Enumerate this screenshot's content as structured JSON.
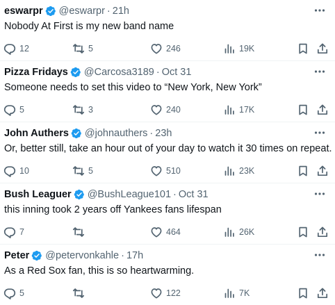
{
  "colors": {
    "verified_badge": "#1d9bf0",
    "secondary_text": "#536471",
    "primary_text": "#0f1419",
    "divider": "#eff3f4"
  },
  "icons": [
    "verified-badge-icon",
    "more-icon",
    "reply-icon",
    "retweet-icon",
    "like-icon",
    "views-icon",
    "bookmark-icon",
    "share-icon"
  ],
  "tweets": [
    {
      "name": "eswarpr",
      "handle": "@eswarpr",
      "sep": "·",
      "time": "21h",
      "text": "Nobody At First is my new band name",
      "replies": "12",
      "retweets": "5",
      "likes": "246",
      "views": "19K"
    },
    {
      "name": "Pizza Fridays",
      "handle": "@Carcosa3189",
      "sep": "·",
      "time": "Oct 31",
      "text": "Someone needs to set this video to “New York, New York”",
      "replies": "5",
      "retweets": "3",
      "likes": "240",
      "views": "17K"
    },
    {
      "name": "John Authers",
      "handle": "@johnauthers",
      "sep": "·",
      "time": "23h",
      "text": "Or, better still, take an hour out of your day to watch it 30 times on repeat.",
      "replies": "10",
      "retweets": "5",
      "likes": "510",
      "views": "23K"
    },
    {
      "name": "Bush Leaguer",
      "handle": "@BushLeague101",
      "sep": "·",
      "time": "Oct 31",
      "text": "this inning took 2 years off Yankees fans lifespan",
      "replies": "7",
      "retweets": "",
      "likes": "464",
      "views": "26K"
    },
    {
      "name": "Peter",
      "handle": "@petervonkahle",
      "sep": "·",
      "time": "17h",
      "text": "As a Red Sox fan, this is so heartwarming.",
      "replies": "5",
      "retweets": "",
      "likes": "122",
      "views": "7K"
    }
  ]
}
